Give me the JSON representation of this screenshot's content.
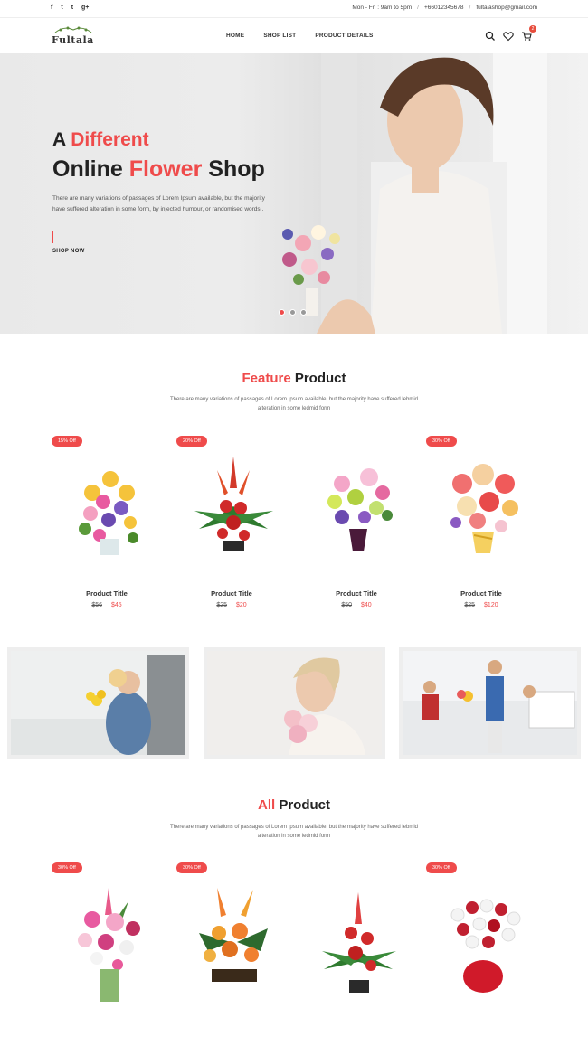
{
  "topbar": {
    "social": [
      "f",
      "t",
      "t",
      "g+"
    ],
    "hours": "Mon - Fri : 9am to 5pm",
    "phone": "+66012345678",
    "email": "fultalashop@gmail.com",
    "separator": "/"
  },
  "header": {
    "logo": "Fultala",
    "nav": [
      "HOME",
      "SHOP LIST",
      "PRODUCT DETAILS"
    ],
    "cart_count": "2"
  },
  "hero": {
    "line1_a": "A",
    "line1_b": "Different",
    "line2_a": "Online",
    "line2_b": "Flower",
    "line2_c": "Shop",
    "text": "There are many variations of passages of Lorem Ipsum available, but the majority have suffered alteration in some form, by injected humour, or randomised words..",
    "cta": "SHOP NOW"
  },
  "feature": {
    "title_a": "Feature",
    "title_b": "Product",
    "desc": "There are many variations of passages of Lorem Ipsum available, but the majority have suffered lebmid alteration in some ledmid form",
    "products": [
      {
        "badge": "15% Off",
        "title": "Product Title",
        "old": "$56",
        "new": "$45"
      },
      {
        "badge": "20% Off",
        "title": "Product Title",
        "old": "$25",
        "new": "$20"
      },
      {
        "badge": "",
        "title": "Product Title",
        "old": "$50",
        "new": "$40"
      },
      {
        "badge": "30% Off",
        "title": "Product Title",
        "old": "$25",
        "new": "$120"
      }
    ]
  },
  "all": {
    "title_a": "All",
    "title_b": "Product",
    "desc": "There are many variations of passages of Lorem Ipsum available, but the majority have suffered lebmid alteration in some ledmid form",
    "badges": [
      "30% Off",
      "30% Off",
      "",
      "30% Off"
    ]
  },
  "colors": {
    "accent": "#ef4b4b",
    "text": "#222222"
  }
}
